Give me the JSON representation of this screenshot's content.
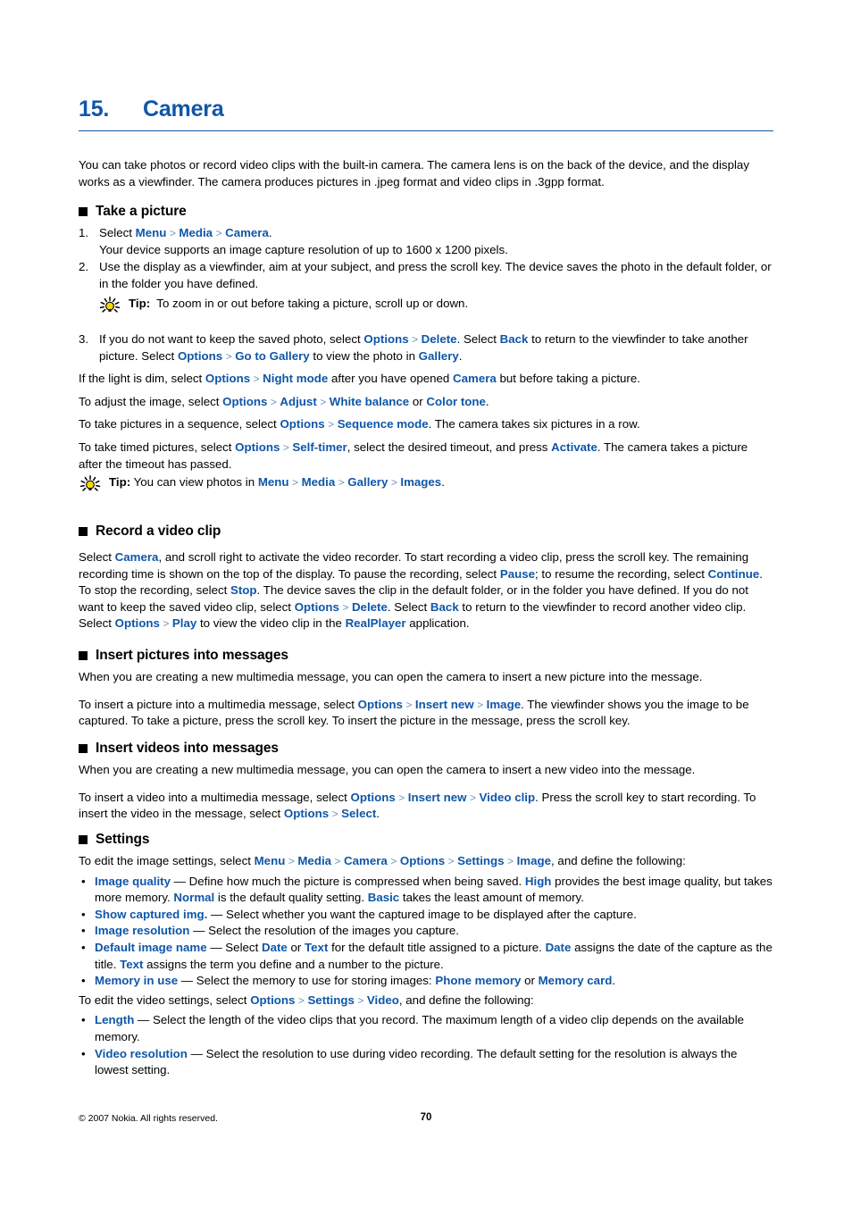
{
  "chapter": {
    "number": "15.",
    "title": "Camera"
  },
  "intro": {
    "text": "You can take photos or record video clips with the built-in camera. The camera lens is on the back of the device, and the display works as a viewfinder. The camera produces pictures in .jpeg format and video clips in .3gpp format."
  },
  "sections": {
    "take_picture": {
      "heading": "Take a picture",
      "step1": {
        "num": "1.",
        "lead": "Select ",
        "menu": "Menu",
        "media": "Media",
        "camera": "Camera",
        "tail": ".",
        "sub": "Your device supports an image capture resolution of up to 1600 x 1200 pixels."
      },
      "step2": {
        "num": "2.",
        "text": "Use the display as a viewfinder, aim at your subject, and press the scroll key. The device saves the photo in the default folder, or in the folder you have defined."
      },
      "tip1": {
        "label": "Tip:",
        "text": "To zoom in or out before taking a picture, scroll up or down."
      },
      "step3": {
        "num": "3.",
        "t1": "If you do not want to keep the saved photo, select ",
        "options": "Options",
        "delete": "Delete",
        "t2": ". Select ",
        "back": "Back",
        "t3": " to return to the viewfinder to take another picture. Select ",
        "options2": "Options",
        "gotogallery": "Go to Gallery",
        "t4": " to view the photo in ",
        "gallery": "Gallery",
        "t5": "."
      },
      "p_night": {
        "t1": "If the light is dim, select ",
        "options": "Options",
        "night": "Night mode",
        "t2": " after you have opened ",
        "camera": "Camera",
        "t3": " but before taking a picture."
      },
      "p_adjust": {
        "t1": "To adjust the image, select ",
        "options": "Options",
        "adjust": "Adjust",
        "white": "White balance",
        "t2": " or ",
        "color": "Color tone",
        "t3": "."
      },
      "p_sequence": {
        "t1": "To take pictures in a sequence, select ",
        "options": "Options",
        "sequence": "Sequence mode",
        "t2": ". The camera takes six pictures in a row."
      },
      "p_timer": {
        "t1": "To take timed pictures, select ",
        "options": "Options",
        "selftimer": "Self-timer",
        "t2": ", select the desired timeout, and press ",
        "activate": "Activate",
        "t3": ". The camera takes a picture after the timeout has passed."
      },
      "tip2": {
        "label": "Tip:",
        "lead": " You can view photos in ",
        "menu": "Menu",
        "media": "Media",
        "gallery": "Gallery",
        "images": "Images",
        "tail": "."
      }
    },
    "record_video": {
      "heading": "Record a video clip",
      "p1": {
        "t1": "Select ",
        "camera": "Camera",
        "t2": ", and scroll right to activate the video recorder. To start recording a video clip, press the scroll key. The remaining recording time is shown on the top of the display. To pause the recording, select ",
        "pause": "Pause",
        "t3": "; to resume the recording, select ",
        "continue": "Continue",
        "t4": ". To stop the recording, select ",
        "stop": "Stop",
        "t5": ". The device saves the clip in the default folder, or in the folder you have defined. If you do not want to keep the saved video clip, select ",
        "options": "Options",
        "delete": "Delete",
        "t6": ". Select ",
        "back": "Back",
        "t7": " to return to the viewfinder to record another video clip. Select ",
        "options2": "Options",
        "play": "Play",
        "t8": " to view the video clip in the ",
        "realplayer": "RealPlayer",
        "t9": " application."
      }
    },
    "insert_pictures": {
      "heading": "Insert pictures into messages",
      "p1": "When you are creating a new multimedia message, you can open the camera to insert a new picture into the message.",
      "p2": {
        "t1": "To insert a picture into a multimedia message, select ",
        "options": "Options",
        "insertnew": "Insert new",
        "image": "Image",
        "t2": ". The viewfinder shows you the image to be captured. To take a picture, press the scroll key. To insert the picture in the message, press the scroll key."
      }
    },
    "insert_videos": {
      "heading": "Insert videos into messages",
      "p1": "When you are creating a new multimedia message, you can open the camera to insert a new video into the message.",
      "p2": {
        "t1": "To insert a video into a multimedia message, select ",
        "options": "Options",
        "insertnew": "Insert new",
        "videoclip": "Video clip",
        "t2": ". Press the scroll key to start recording. To insert the video in the message, select ",
        "options2": "Options",
        "select": "Select",
        "t3": "."
      }
    },
    "settings": {
      "heading": "Settings",
      "image_intro": {
        "t1": "To edit the image settings, select ",
        "menu": "Menu",
        "media": "Media",
        "camera": "Camera",
        "options": "Options",
        "settings": "Settings",
        "image": "Image",
        "t2": ", and define the following:"
      },
      "image_bullets": [
        {
          "term": "Image quality",
          "t1": " — Define how much the picture is compressed when being saved. ",
          "v1": "High",
          "t2": " provides the best image quality, but takes more memory. ",
          "v2": "Normal",
          "t3": " is the default quality setting. ",
          "v3": "Basic",
          "t4": " takes the least amount of memory."
        },
        {
          "term": "Show captured img.",
          "t1": " — Select whether you want the captured image to be displayed after the capture."
        },
        {
          "term": "Image resolution",
          "t1": " — Select the resolution of the images you capture."
        },
        {
          "term": "Default image name",
          "t1": " — Select ",
          "v1": "Date",
          "t2": " or ",
          "v2": "Text",
          "t3": " for the default title assigned to a picture. ",
          "v3": "Date",
          "t4": " assigns the date of the capture as the title. ",
          "v4": "Text",
          "t5": " assigns the term you define and a number to the picture."
        },
        {
          "term": "Memory in use",
          "t1": " — Select the memory to use for storing images: ",
          "v1": "Phone memory",
          "t2": " or ",
          "v2": "Memory card",
          "t3": "."
        }
      ],
      "video_intro": {
        "t1": "To edit the video settings, select ",
        "options": "Options",
        "settings": "Settings",
        "video": "Video",
        "t2": ", and define the following:"
      },
      "video_bullets": [
        {
          "term": "Length",
          "t1": " — Select the length of the video clips that you record. The maximum length of a video clip depends on the available memory."
        },
        {
          "term": "Video resolution",
          "t1": " — Select the resolution to use during video recording. The default setting for the resolution is always the lowest setting."
        }
      ]
    }
  },
  "footer": {
    "copyright": "© 2007 Nokia. All rights reserved.",
    "page_number": "70"
  },
  "icons": {
    "tip": "lightbulb-icon",
    "section_marker": "square-bullet-icon",
    "separator": "chevron-right-separator"
  },
  "colors": {
    "accent_blue": "#0f56a8",
    "separator_blue": "#6f95c4",
    "bulb_yellow": "#f5d800",
    "text": "#000000",
    "background": "#ffffff"
  }
}
